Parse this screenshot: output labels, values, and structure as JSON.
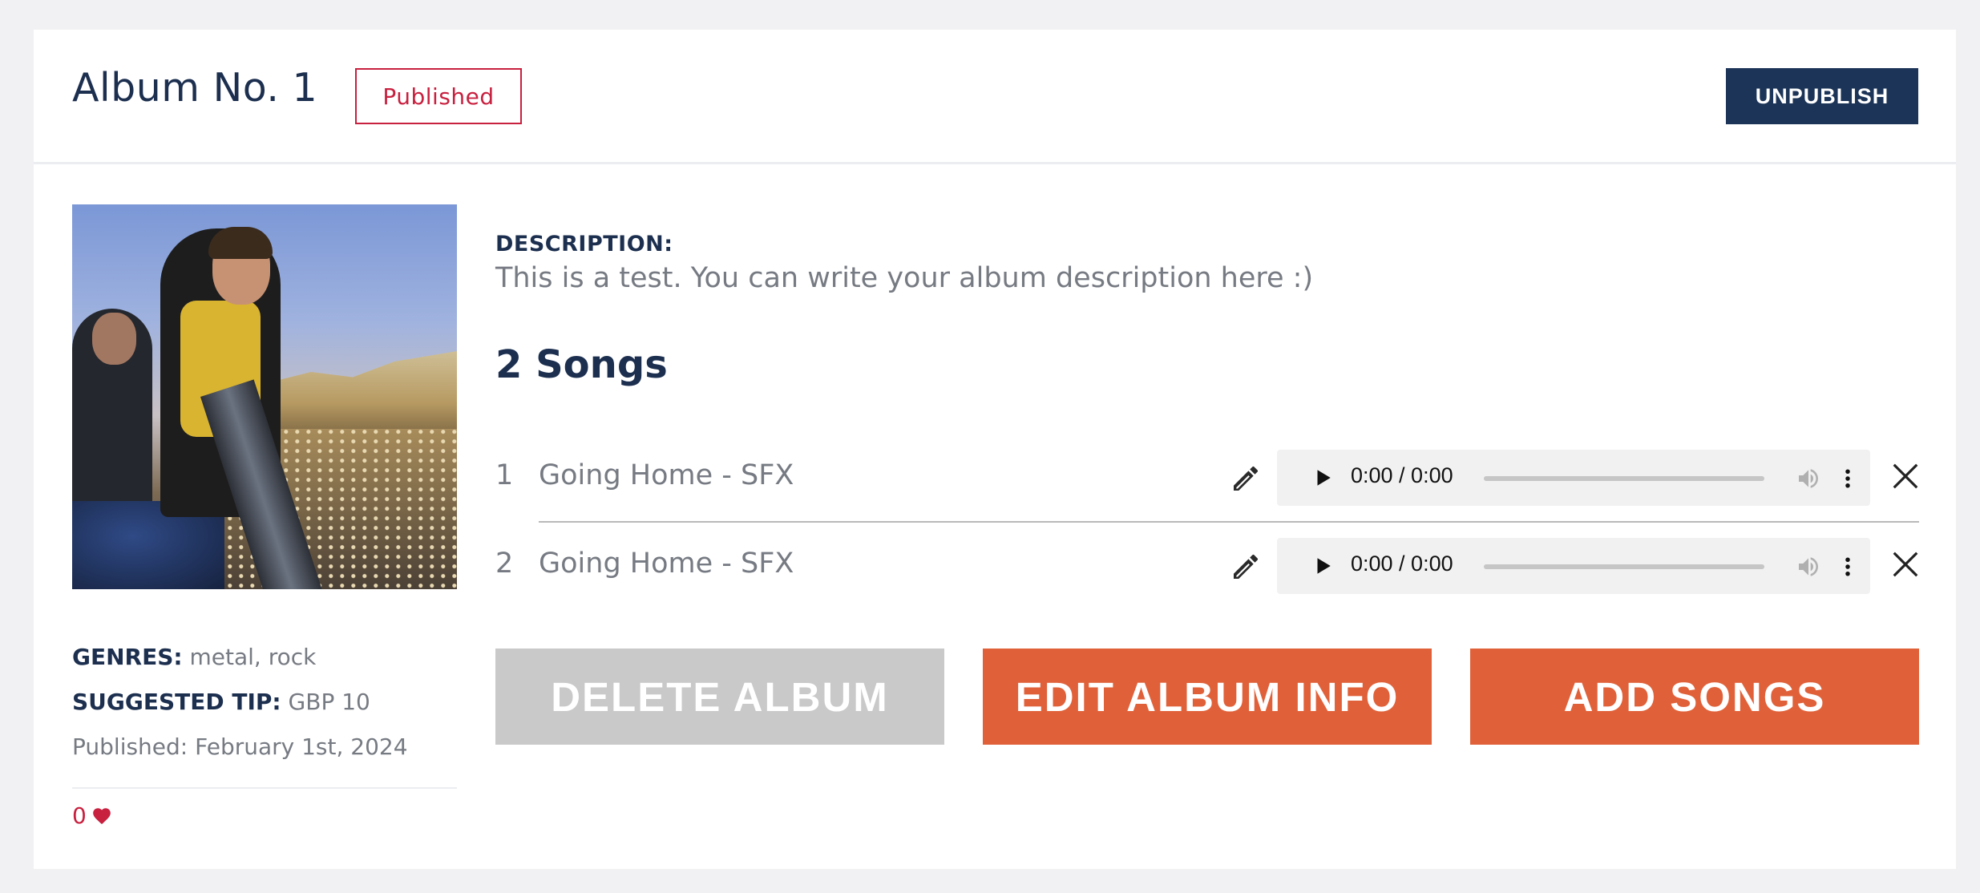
{
  "header": {
    "title": "Album No. 1",
    "status": "Published",
    "unpublish_label": "UNPUBLISH"
  },
  "sidebar": {
    "genres_label": "GENRES:",
    "genres_value": "metal, rock",
    "tip_label": "SUGGESTED TIP:",
    "tip_value": "GBP 10",
    "published": "Published: February 1st, 2024",
    "likes": "0"
  },
  "main": {
    "description_label": "DESCRIPTION:",
    "description_text": "This is a test. You can write your album description here :)",
    "songs_count_label": "2 Songs",
    "songs": [
      {
        "number": "1",
        "title": "Going Home - SFX",
        "time": "0:00 / 0:00",
        "progress": 0
      },
      {
        "number": "2",
        "title": "Going Home - SFX",
        "time": "0:00 / 0:00",
        "progress": 0
      }
    ],
    "buttons": {
      "delete": "DELETE ALBUM",
      "edit": "EDIT ALBUM INFO",
      "add": "ADD SONGS"
    }
  },
  "colors": {
    "navy": "#1c2f4f",
    "accent_red": "#c8203f",
    "orange": "#e06139",
    "disabled_gray": "#c9c9c9"
  },
  "icons": [
    "edit-pencil-icon",
    "play-icon",
    "volume-icon",
    "more-vertical-icon",
    "close-icon",
    "heart-icon"
  ]
}
